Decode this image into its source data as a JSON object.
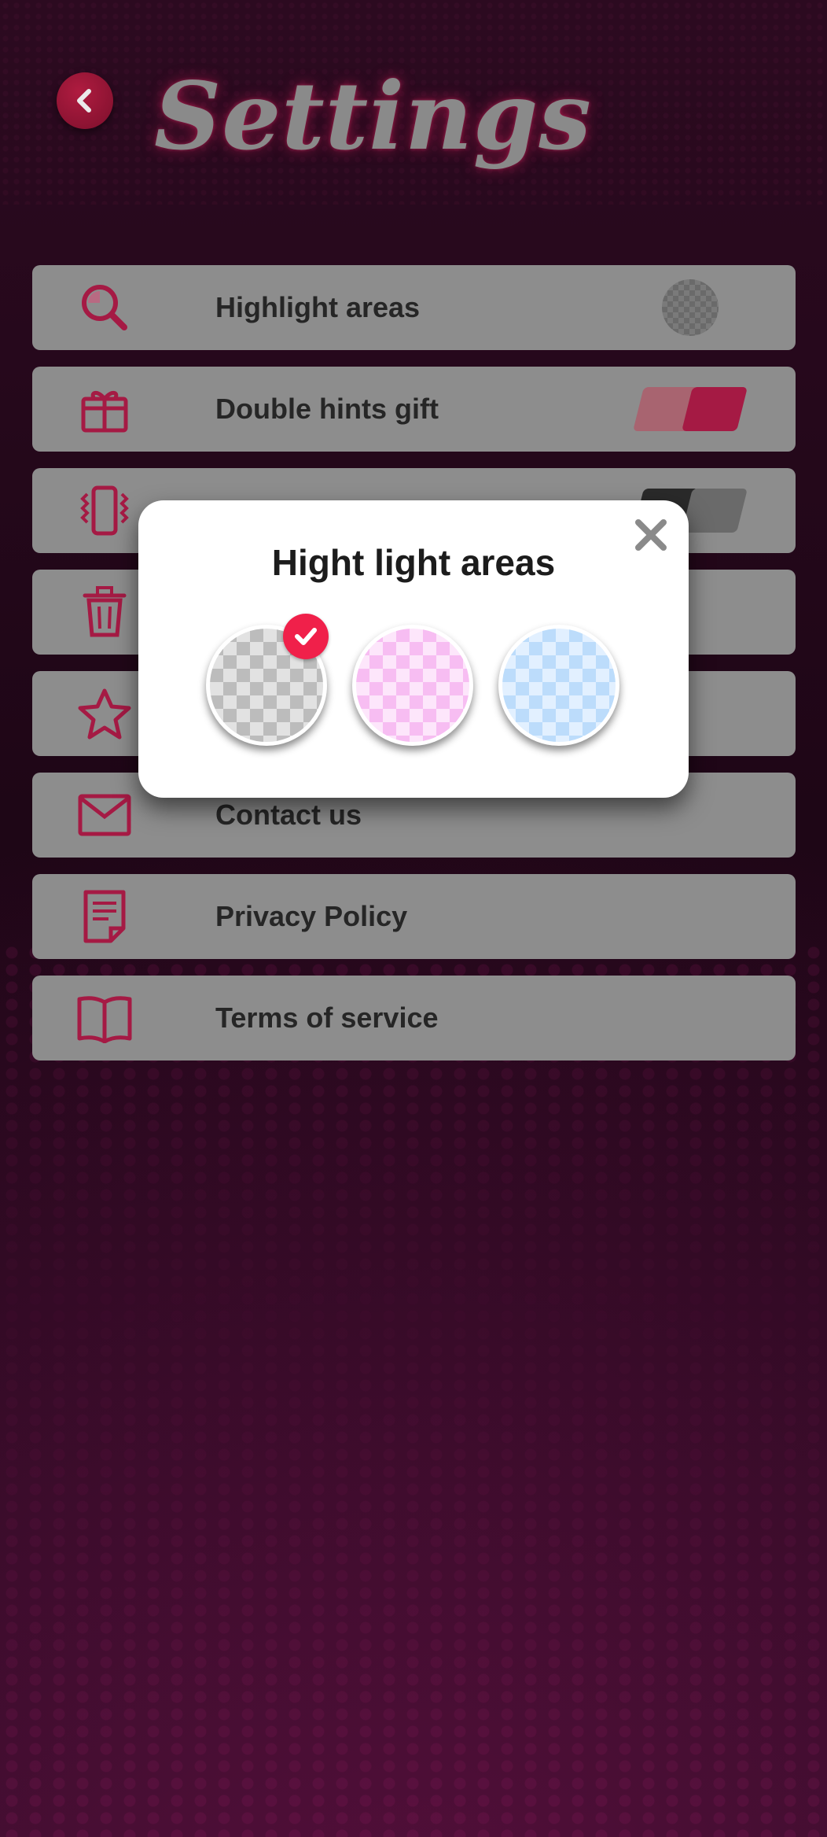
{
  "page_title": "Settings",
  "colors": {
    "accent": "#a51a44",
    "toggle_off": "#2a2a2a",
    "check_badge": "#f0204a"
  },
  "settings": {
    "items": [
      {
        "label": "Highlight areas",
        "icon": "magnifier-icon",
        "control": "color-swatch"
      },
      {
        "label": "Double hints gift",
        "icon": "gift-icon",
        "control": "toggle",
        "state": "on"
      },
      {
        "label": "",
        "icon": "vibrate-phone-icon",
        "control": "toggle",
        "state": "off"
      },
      {
        "label": "",
        "icon": "trash-icon"
      },
      {
        "label": "",
        "icon": "star-icon"
      },
      {
        "label": "Contact us",
        "icon": "mail-icon"
      },
      {
        "label": "Privacy Policy",
        "icon": "document-icon"
      },
      {
        "label": "Terms of service",
        "icon": "book-icon"
      }
    ]
  },
  "modal": {
    "title": "Hight light areas",
    "options": [
      {
        "color": "gray",
        "selected": true
      },
      {
        "color": "pink",
        "selected": false
      },
      {
        "color": "blue",
        "selected": false
      }
    ],
    "close_icon": "close-icon"
  }
}
